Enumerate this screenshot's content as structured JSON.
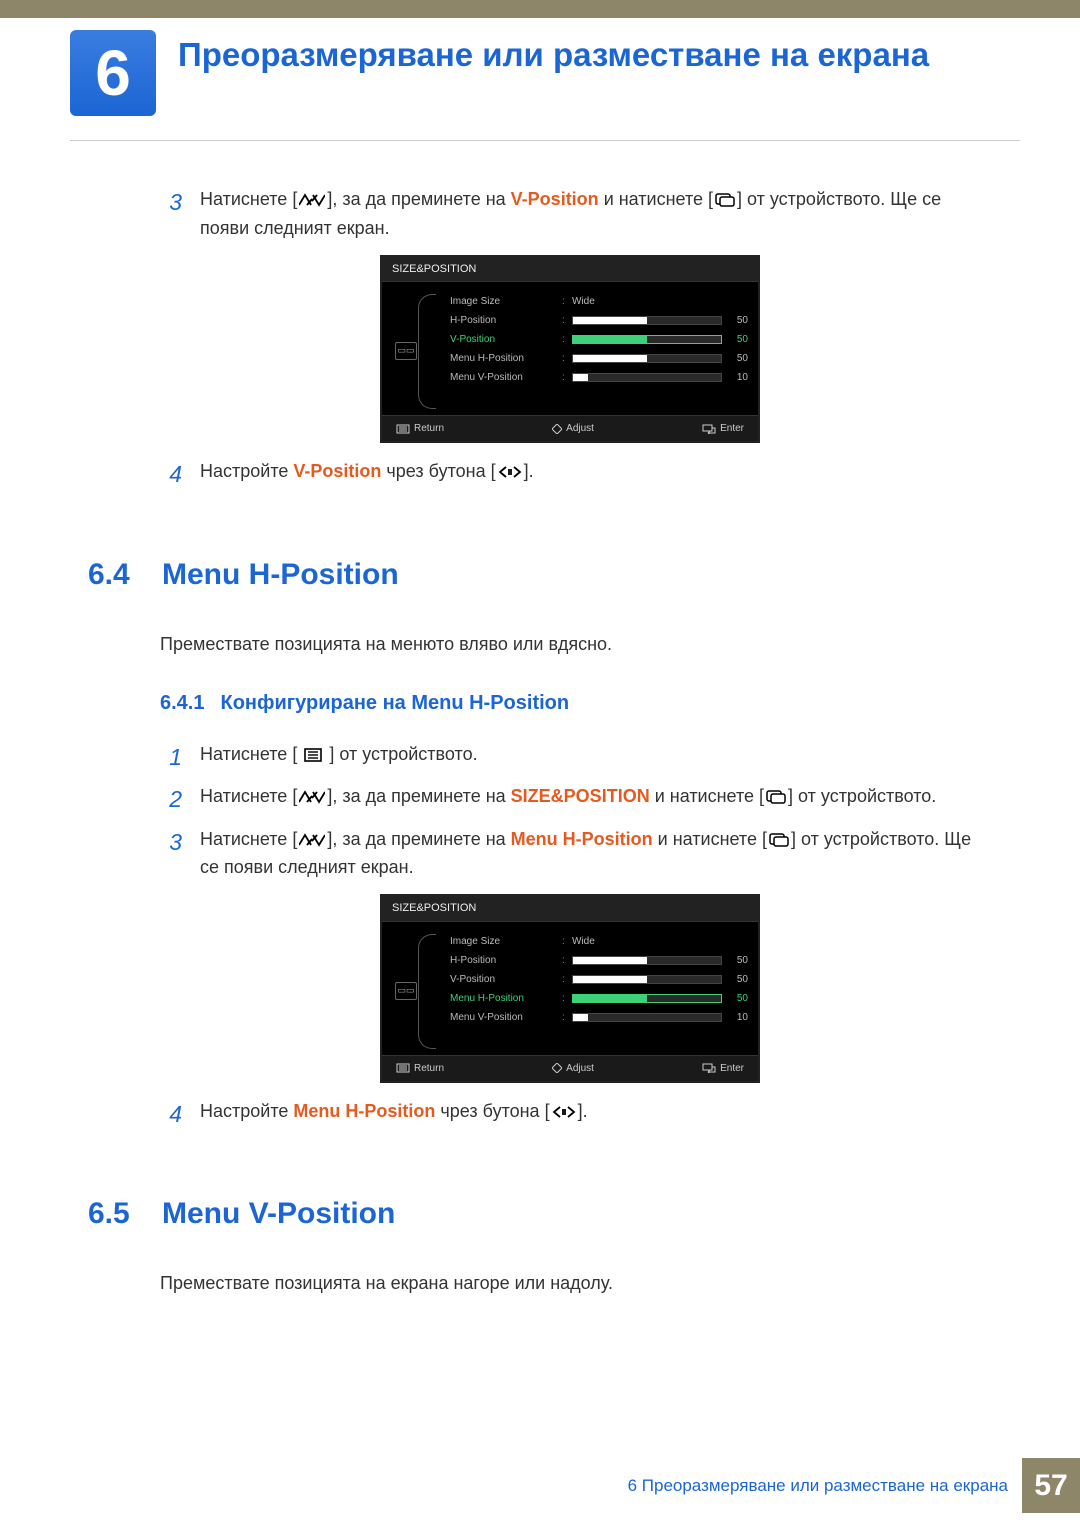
{
  "chapter": {
    "number": "6",
    "title": "Преоразмеряване или разместване на екрана"
  },
  "block1": {
    "step3": {
      "num": "3",
      "pre": "Натиснете [",
      "mid1": "], за да преминете на ",
      "hl": "V-Position",
      "mid2": " и натиснете [",
      "post": "] от устройството. Ще се появи следният екран."
    },
    "step4": {
      "num": "4",
      "pre": "Настройте ",
      "hl": "V-Position",
      "mid": " чрез бутона [",
      "post": "]."
    }
  },
  "osd1": {
    "title": "SIZE&POSITION",
    "rows": [
      {
        "label": "Image Size",
        "type": "text",
        "value": "Wide",
        "selected": false
      },
      {
        "label": "H-Position",
        "type": "slider",
        "value": "50",
        "fill": 50,
        "selected": false
      },
      {
        "label": "V-Position",
        "type": "slider",
        "value": "50",
        "fill": 50,
        "selected": true
      },
      {
        "label": "Menu H-Position",
        "type": "slider",
        "value": "50",
        "fill": 50,
        "selected": false
      },
      {
        "label": "Menu V-Position",
        "type": "slider",
        "value": "10",
        "fill": 10,
        "selected": false
      }
    ],
    "footer": {
      "return": "Return",
      "adjust": "Adjust",
      "enter": "Enter"
    }
  },
  "section64": {
    "num": "6.4",
    "title": "Menu H-Position",
    "desc": "Премествате позицията на менюто вляво или вдясно."
  },
  "sub641": {
    "num": "6.4.1",
    "title": "Конфигуриране на Menu H-Position",
    "step1": {
      "num": "1",
      "pre": "Натиснете [ ",
      "post": " ] от устройството."
    },
    "step2": {
      "num": "2",
      "pre": "Натиснете [",
      "mid1": "], за да преминете на ",
      "hl": "SIZE&POSITION",
      "mid2": " и натиснете [",
      "post": "] от устройството."
    },
    "step3": {
      "num": "3",
      "pre": "Натиснете [",
      "mid1": "], за да преминете на ",
      "hl": "Menu H-Position",
      "mid2": " и натиснете [",
      "post": "] от устройството. Ще се появи следният екран."
    },
    "step4": {
      "num": "4",
      "pre": "Настройте ",
      "hl": "Menu H-Position",
      "mid": " чрез бутона [",
      "post": "]."
    }
  },
  "osd2": {
    "title": "SIZE&POSITION",
    "rows": [
      {
        "label": "Image Size",
        "type": "text",
        "value": "Wide",
        "selected": false
      },
      {
        "label": "H-Position",
        "type": "slider",
        "value": "50",
        "fill": 50,
        "selected": false
      },
      {
        "label": "V-Position",
        "type": "slider",
        "value": "50",
        "fill": 50,
        "selected": false
      },
      {
        "label": "Menu H-Position",
        "type": "slider",
        "value": "50",
        "fill": 50,
        "selected": true
      },
      {
        "label": "Menu V-Position",
        "type": "slider",
        "value": "10",
        "fill": 10,
        "selected": false
      }
    ],
    "footer": {
      "return": "Return",
      "adjust": "Adjust",
      "enter": "Enter"
    }
  },
  "section65": {
    "num": "6.5",
    "title": "Menu V-Position",
    "desc": "Премествате позицията на екрана нагоре или надолу."
  },
  "footer": {
    "text": "6 Преоразмеряване или разместване на екрана",
    "page": "57"
  }
}
